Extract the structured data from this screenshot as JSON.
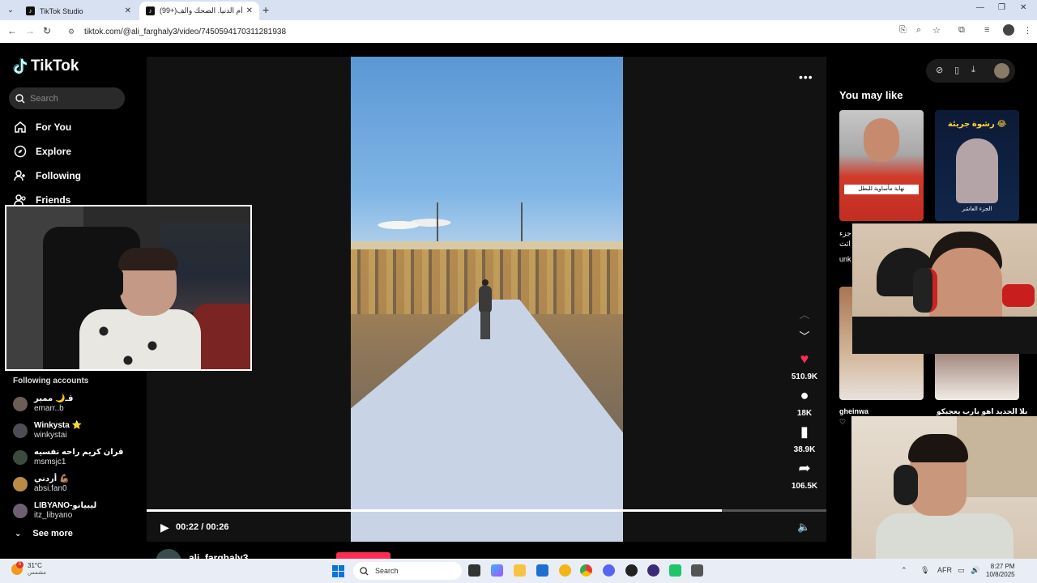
{
  "browser": {
    "tabs": [
      {
        "title": "TikTok Studio",
        "active": false
      },
      {
        "title": "(99+)مصر أم الدنيا. الضحك والف...",
        "active": true
      }
    ],
    "url": "tiktok.com/@ali_farghaly3/video/7450594170311281938"
  },
  "sidebar": {
    "logo_text": "TikTok",
    "search_placeholder": "Search",
    "nav": [
      {
        "label": "For You",
        "icon": "home-icon"
      },
      {
        "label": "Explore",
        "icon": "compass-icon"
      },
      {
        "label": "Following",
        "icon": "following-icon"
      },
      {
        "label": "Friends",
        "icon": "friends-icon"
      }
    ],
    "following_title": "Following accounts",
    "accounts": [
      {
        "name": "قـ🌙 ممير",
        "handle": "emarr..b"
      },
      {
        "name": "Winkysta ⭐",
        "handle": "winkystai"
      },
      {
        "name": "قران كريم راحه نفسيه",
        "handle": "msmsjc1"
      },
      {
        "name": "أردني 💪🏽",
        "handle": "absi.fan0"
      },
      {
        "name": "LIBYANO-ليبيانو",
        "handle": "itz_libyano"
      }
    ],
    "see_more": "See more"
  },
  "video": {
    "likes": "510.9K",
    "comments": "18K",
    "saves": "38.9K",
    "shares": "106.5K",
    "time": "00:22 / 00:26",
    "progress_fraction": 0.846,
    "author": "ali_farghaly3"
  },
  "right_panel": {
    "title": "You may like",
    "thumb1_caption": "نهاية مأساوية للبطل",
    "thumb2_title": "رشوة جريئة 😂",
    "thumb2_sub": "الجزء العاشر",
    "text_lines": [
      "جزء",
      "اثث",
      "unk"
    ],
    "row2_left_name": "gheinwa",
    "row2_right_caption": "بلا الجديد اهو يارب يعجبكو"
  },
  "taskbar": {
    "weather_temp": "31°C",
    "weather_desc": "مشمس",
    "weather_badge": "5",
    "search_placeholder": "Search",
    "lang": "AFR",
    "time": "8:27 PM",
    "date": "10/8/2025"
  },
  "colors": {
    "accent": "#fe2c55",
    "bg": "#000000",
    "panel": "#121212"
  }
}
